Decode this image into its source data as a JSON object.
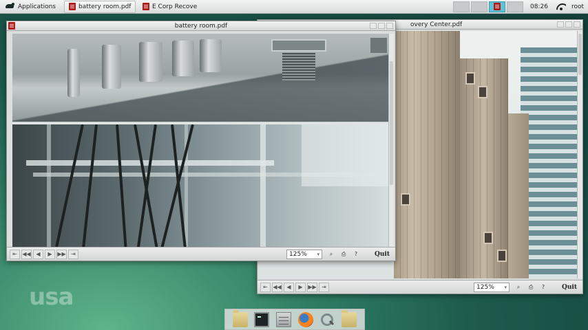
{
  "topbar": {
    "applications_label": "Applications",
    "tasks": [
      {
        "label": "battery room.pdf"
      },
      {
        "label": "E Corp Recovery..."
      }
    ],
    "clock": "08:26",
    "user": "root"
  },
  "window_back": {
    "title": "E Corp Recovery Center.pdf",
    "title_visible": "overy Center.pdf",
    "zoom": "125%",
    "quit_label": "Quit"
  },
  "window_front": {
    "title": "battery room.pdf",
    "zoom": "125%",
    "quit_label": "Quit"
  },
  "watermark": "usa",
  "colors": {
    "pdf_icon": "#b01c1c",
    "active_workspace": "#5fc2d6",
    "desktop": "#2f7d63"
  },
  "icons": {
    "toolbar_nav": [
      "skip-back-icon",
      "rewind-icon",
      "prev-icon",
      "next-icon",
      "fast-forward-icon",
      "skip-forward-icon"
    ],
    "toolbar_tools": [
      "find-icon",
      "print-icon",
      "help-icon"
    ]
  }
}
